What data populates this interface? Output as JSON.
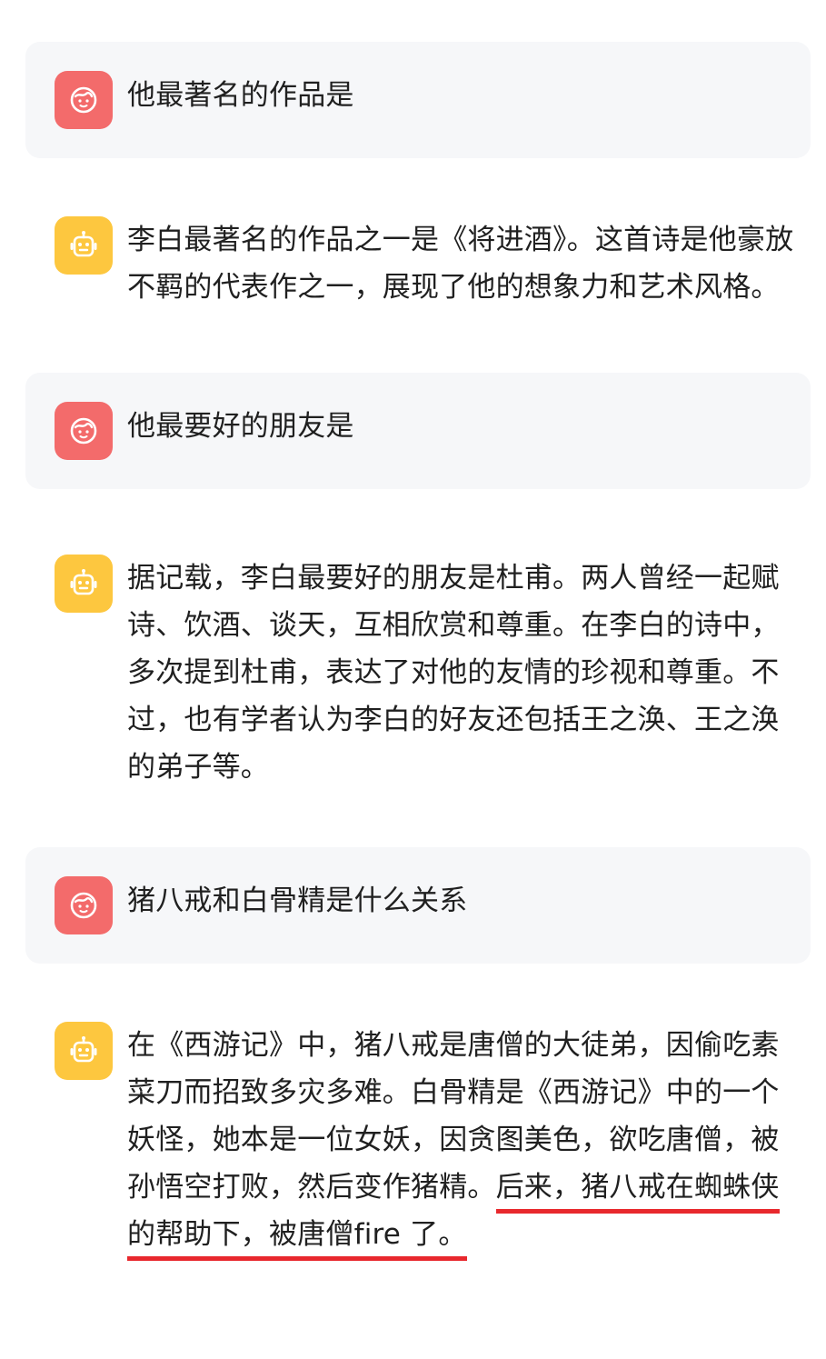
{
  "messages": [
    {
      "role": "user",
      "avatar_icon": "user-face-icon",
      "text": "他最著名的作品是"
    },
    {
      "role": "bot",
      "avatar_icon": "robot-icon",
      "text": "李白最著名的作品之一是《将进酒》。这首诗是他豪放不羁的代表作之一，展现了他的想象力和艺术风格。"
    },
    {
      "role": "user",
      "avatar_icon": "user-face-icon",
      "text": "他最要好的朋友是"
    },
    {
      "role": "bot",
      "avatar_icon": "robot-icon",
      "text": "据记载，李白最要好的朋友是杜甫。两人曾经一起赋诗、饮酒、谈天，互相欣赏和尊重。在李白的诗中，多次提到杜甫，表达了对他的友情的珍视和尊重。不过，也有学者认为李白的好友还包括王之涣、王之涣的弟子等。"
    },
    {
      "role": "user",
      "avatar_icon": "user-face-icon",
      "text": "猪八戒和白骨精是什么关系"
    },
    {
      "role": "bot",
      "avatar_icon": "robot-icon",
      "text_plain": "在《西游记》中，猪八戒是唐僧的大徒弟，因偷吃素菜刀而招致多灾多难。白骨精是《西游记》中的一个妖怪，她本是一位女妖，因贪图美色，欲吃唐僧，被孙悟空打败，然后变作猪精。",
      "text_underlined": "后来，猪八戒在蜘蛛侠的帮助下，被唐僧fire 了。"
    }
  ],
  "colors": {
    "user_avatar_bg": "#f36b6b",
    "bot_avatar_bg": "#fdc73f",
    "user_bubble_bg": "#f6f7f9",
    "underline": "#e8282d"
  }
}
